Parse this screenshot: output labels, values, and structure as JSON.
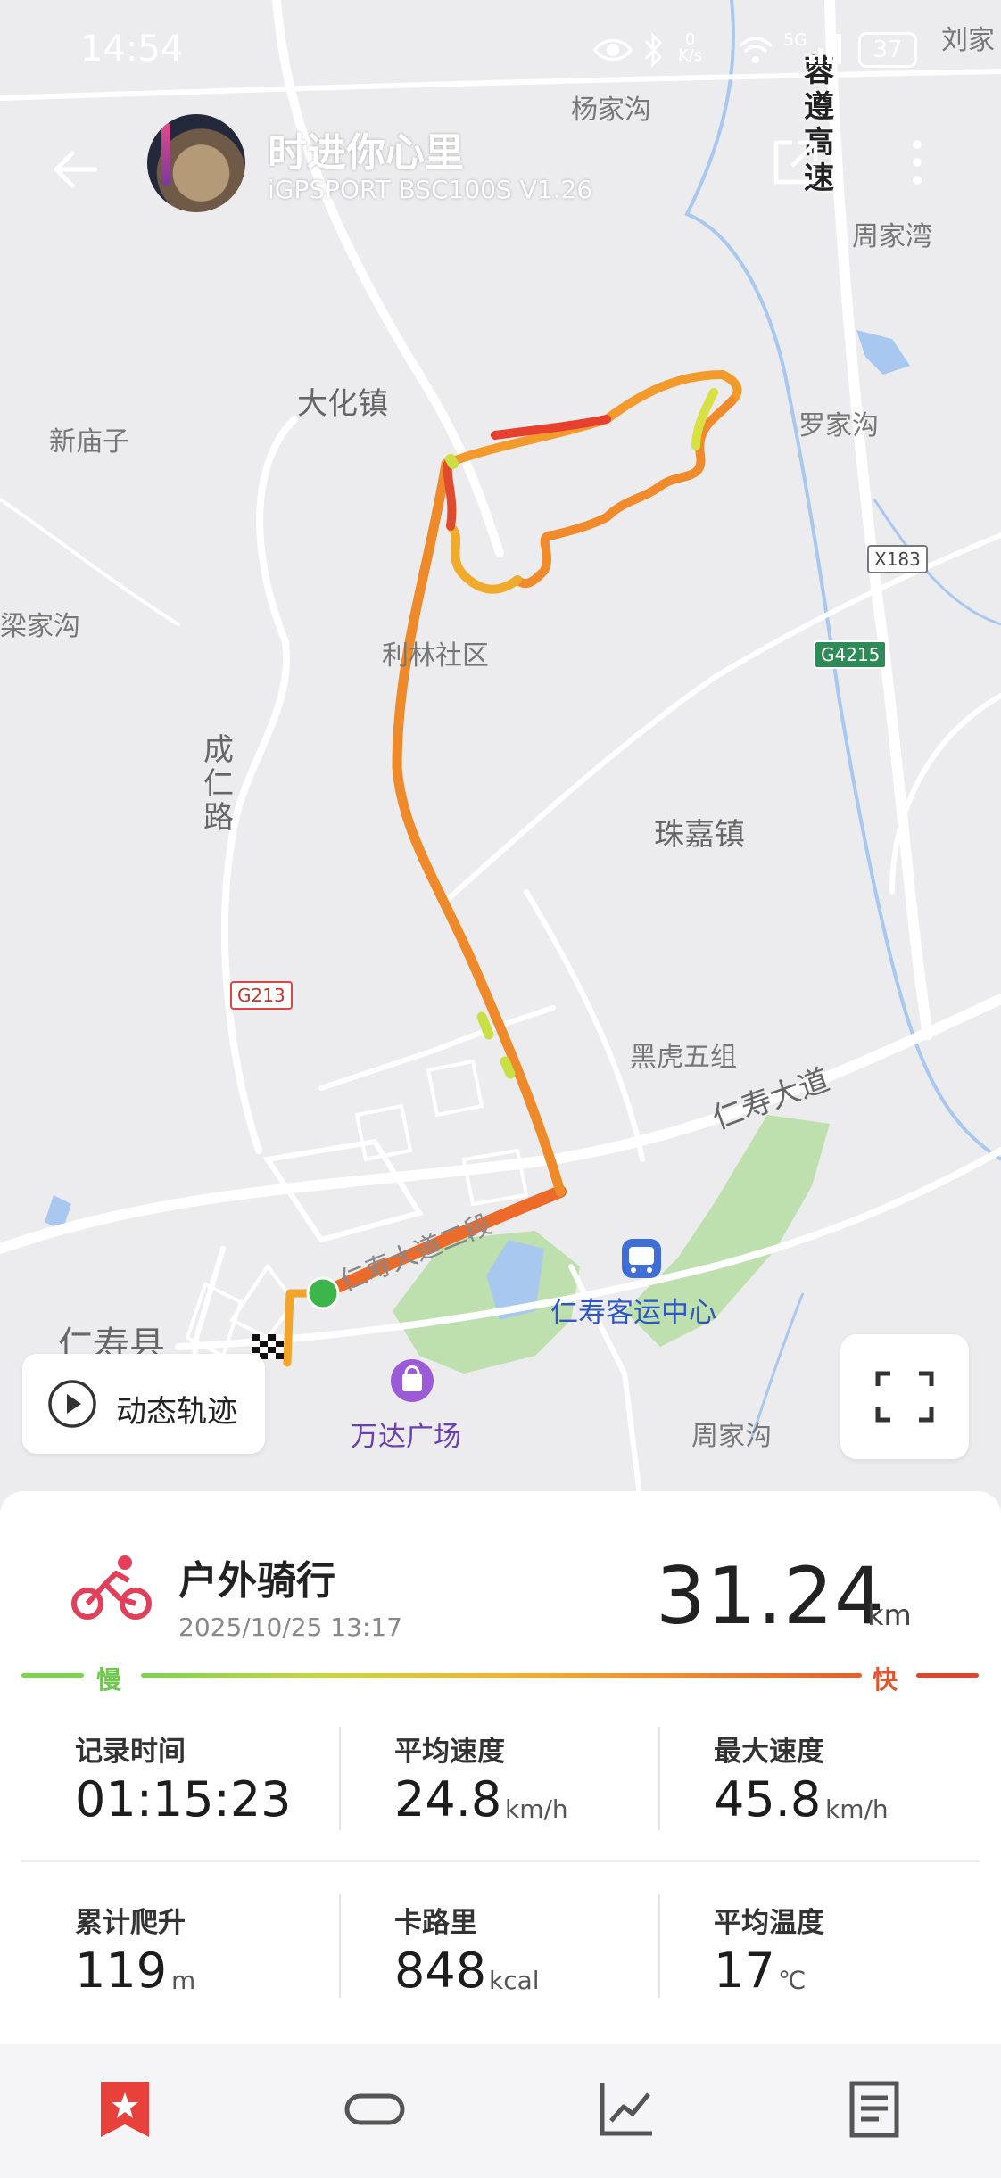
{
  "status_bar": {
    "time": "14:54",
    "net_speed_value": "0",
    "net_speed_unit": "K/s",
    "signal": "5G",
    "battery": "37"
  },
  "header": {
    "username": "时进你心里",
    "device": "iGPSPORT BSC100S  V1.26",
    "back_icon": "back-arrow-icon",
    "share_icon": "share-icon",
    "more_icon": "more-vertical-icon"
  },
  "map": {
    "places": {
      "yangjiagou": "杨家沟",
      "zhoujiawan": "周家湾",
      "liujia": "刘家",
      "dahuazhen": "大化镇",
      "xinmiaozi": "新庙子",
      "luojiagou": "罗家沟",
      "liangjiagou": "梁家沟",
      "likang": "利林社区",
      "chengrenlu": "成仁路",
      "zhujiazhen": "珠嘉镇",
      "heihuwuzu": "黑虎五组",
      "renshoudadao": "仁寿大道",
      "renshoudadao2": "仁寿大道二段",
      "keyun": "仁寿客运中心",
      "renshouxian": "仁寿县",
      "wanda": "万达广场",
      "zhoujiagou": "周家沟",
      "highway": "蓉遵高速"
    },
    "road_badges": {
      "x183": "X183",
      "g4215": "G4215",
      "g213": "G213"
    },
    "dynamic_track_label": "动态轨迹",
    "fullscreen_icon": "fullscreen-icon"
  },
  "activity": {
    "sport": "户外骑行",
    "datetime": "2025/10/25 13:17",
    "distance": "31.24",
    "distance_unit": "km",
    "speed_scale": {
      "slow": "慢",
      "fast": "快"
    },
    "stats": [
      {
        "label": "记录时间",
        "value": "01:15:23",
        "unit": ""
      },
      {
        "label": "平均速度",
        "value": "24.8",
        "unit": "km/h"
      },
      {
        "label": "最大速度",
        "value": "45.8",
        "unit": "km/h"
      },
      {
        "label": "累计爬升",
        "value": "119",
        "unit": "m"
      },
      {
        "label": "卡路里",
        "value": "848",
        "unit": "kcal"
      },
      {
        "label": "平均温度",
        "value": "17",
        "unit": "℃"
      }
    ]
  },
  "bottom_nav": [
    {
      "icon": "bookmark-star-icon",
      "active": true
    },
    {
      "icon": "loop-icon",
      "active": false
    },
    {
      "icon": "chart-line-icon",
      "active": false
    },
    {
      "icon": "document-icon",
      "active": false
    }
  ],
  "colors": {
    "accent": "#e8403a",
    "track_fast": "#e8402e",
    "track_mid": "#f08a2a",
    "track_slow": "#c8e043",
    "start_dot": "#3cb54a"
  }
}
